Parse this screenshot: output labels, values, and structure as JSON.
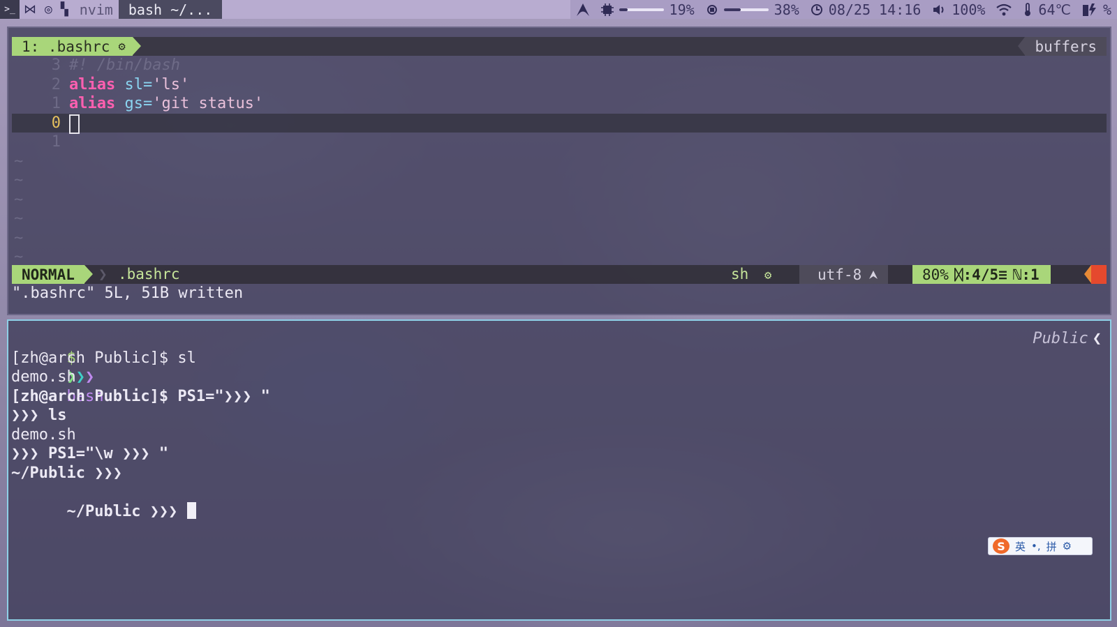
{
  "topbar": {
    "workspaces": [
      {
        "name": "terminal-icon",
        "label": ">_"
      },
      {
        "name": "vscode-icon",
        "label": "⋈"
      },
      {
        "name": "browser-icon",
        "label": "◎"
      },
      {
        "name": "layout-icon",
        "label": "▚"
      }
    ],
    "inactive_title": "nvim",
    "active_title": "bash ~/...",
    "modules": {
      "cpu_percent": "19%",
      "cpu_level": 0.19,
      "memory_percent": "38%",
      "memory_level": 0.38,
      "datetime": "08/25 14:16",
      "volume": "100%",
      "temperature": "64℃",
      "battery": "%"
    }
  },
  "nvim": {
    "tab_label": "1: .bashrc",
    "tab_icon": "gear-icon",
    "buffers_label": "buffers",
    "lines": [
      {
        "num": "3",
        "type": "comment",
        "text": "#! /bin/bash"
      },
      {
        "num": "2",
        "type": "alias",
        "kw": "alias",
        "name": "sl",
        "eq": "=",
        "value": "'ls'"
      },
      {
        "num": "1",
        "type": "alias",
        "kw": "alias",
        "name": "gs",
        "eq": "=",
        "value": "'git status'"
      },
      {
        "num": "0",
        "type": "cursor"
      },
      {
        "num": "1",
        "type": "empty"
      }
    ],
    "tildes": [
      "~",
      "~",
      "~",
      "~",
      "~",
      "~"
    ],
    "statusline": {
      "mode": "NORMAL",
      "separator": "❯",
      "filename": ".bashrc",
      "filetype": "sh",
      "encoding": "utf-8",
      "format_icon": "arch-icon",
      "percent": "80%",
      "line_info": "ᛞ:4/5≡",
      "col_info": "ℕ:1"
    },
    "cmdline": "\".bashrc\" 5L, 51B written"
  },
  "terminal": {
    "dir_label": "Public",
    "dir_arrow": "❮",
    "prompt_dollar": "$",
    "prompt_cmd": "bash",
    "lines": [
      "[zh@arch Public]$ sl",
      "demo.sh",
      "[zh@arch Public]$ PS1=\"❯❯❯ \"",
      "❯❯❯ ls",
      "demo.sh",
      "❯❯❯ PS1=\"\\w ❯❯❯ \"",
      "~/Public ❯❯❯",
      "~/Public ❯❯❯ "
    ]
  },
  "ime": {
    "logo": "S",
    "mode": "英",
    "punct": "•,",
    "pinyin": "拼",
    "settings_icon": "gear-icon"
  },
  "colors": {
    "accent_green": "#a9d67a",
    "keyword_pink": "#ff5fb0",
    "identifier_blue": "#8ad4f0",
    "term_border": "#8ed0e6"
  }
}
